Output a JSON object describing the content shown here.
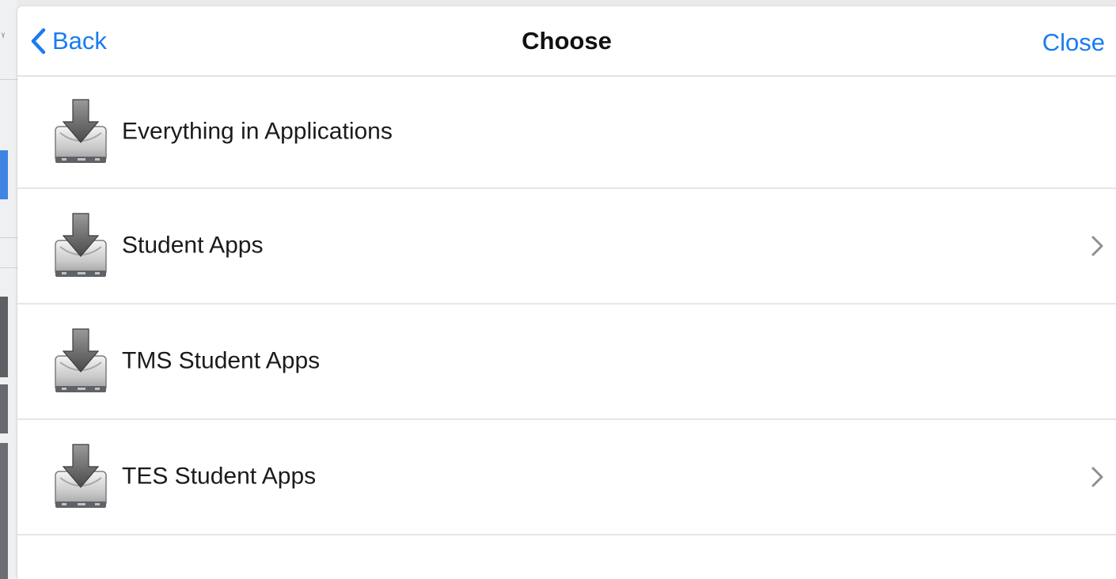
{
  "navbar": {
    "back_label": "Back",
    "title": "Choose",
    "close_label": "Close"
  },
  "list": {
    "items": [
      {
        "label": "Everything in Applications",
        "icon": "installer-drive-icon",
        "has_disclosure": false
      },
      {
        "label": "Student Apps",
        "icon": "installer-drive-icon",
        "has_disclosure": true
      },
      {
        "label": "TMS Student Apps",
        "icon": "installer-drive-icon",
        "has_disclosure": false
      },
      {
        "label": "TES Student Apps",
        "icon": "installer-drive-icon",
        "has_disclosure": true
      }
    ]
  },
  "colors": {
    "accent": "#1a7bf2",
    "separator": "#e6e6e8",
    "chevron": "#8e8e93"
  }
}
